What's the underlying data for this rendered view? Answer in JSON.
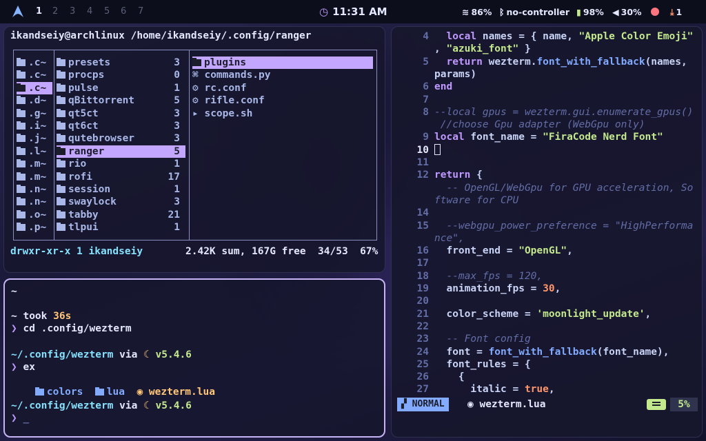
{
  "topbar": {
    "workspaces": [
      "1",
      "2",
      "3",
      "4",
      "5",
      "6",
      "7"
    ],
    "active_workspace": "1",
    "clock": "11:31 AM",
    "wifi": "86%",
    "bluetooth": "no-controller",
    "battery": "98%",
    "volume": "30%",
    "updates": "1"
  },
  "ranger": {
    "title": "ikandseiy@archlinux /home/ikandseiy/.config/ranger",
    "col1": [
      ".c~",
      ".c~",
      ".c~",
      ".d~",
      ".g~",
      ".i~",
      ".j~",
      ".l~",
      ".m~",
      ".m~",
      ".n~",
      ".n~",
      ".o~",
      ".p~"
    ],
    "col1_selected_index": 2,
    "col2": [
      {
        "name": "presets",
        "count": "3"
      },
      {
        "name": "procps",
        "count": "0"
      },
      {
        "name": "pulse",
        "count": "1"
      },
      {
        "name": "qBittorrent",
        "count": "5"
      },
      {
        "name": "qt5ct",
        "count": "3"
      },
      {
        "name": "qt6ct",
        "count": "3"
      },
      {
        "name": "qutebrowser",
        "count": "3"
      },
      {
        "name": "ranger",
        "count": "5"
      },
      {
        "name": "rio",
        "count": "1"
      },
      {
        "name": "rofi",
        "count": "17"
      },
      {
        "name": "session",
        "count": "1"
      },
      {
        "name": "swaylock",
        "count": "3"
      },
      {
        "name": "tabby",
        "count": "21"
      },
      {
        "name": "tlpui",
        "count": "1"
      }
    ],
    "col2_selected_index": 7,
    "col3": [
      {
        "name": "plugins",
        "icon": "folder-icon"
      },
      {
        "name": "commands.py",
        "icon": "python-icon"
      },
      {
        "name": "rc.conf",
        "icon": "gear-icon"
      },
      {
        "name": "rifle.conf",
        "icon": "gear-icon"
      },
      {
        "name": "scope.sh",
        "icon": "terminal-icon"
      }
    ],
    "status_perms": "drwxr-xr-x 1 ikandseiy",
    "status_info": "2.42K sum, 167G free  34/53  67%"
  },
  "terminal": {
    "line1": "~",
    "took_label": "~ took ",
    "took_value": "36s",
    "cmd1_prompt": "❯",
    "cmd1": "cd .config/wezterm",
    "path1": "~/.config/wezterm",
    "via": " via ",
    "version": "v5.4.6",
    "cmd2": "ex",
    "ls_items": [
      "colors",
      "lua",
      "wezterm.lua"
    ],
    "path2": "~/.config/wezterm",
    "prompt_end": "❯"
  },
  "editor": {
    "lines": [
      {
        "n": "4",
        "segs": [
          [
            "  ",
            ""
          ],
          [
            "local",
            "kw"
          ],
          [
            " names = { name, ",
            ""
          ],
          [
            "\"Apple Color Emoji\"",
            "str"
          ]
        ]
      },
      {
        "n": "",
        "segs": [
          [
            ", ",
            ""
          ],
          [
            "\"azuki_font\"",
            "str"
          ],
          [
            " }",
            ""
          ]
        ]
      },
      {
        "n": "5",
        "segs": [
          [
            "  ",
            ""
          ],
          [
            "return",
            "kw"
          ],
          [
            " wezterm.",
            ""
          ],
          [
            "font_with_fallback",
            "fn"
          ],
          [
            "(names,",
            ""
          ]
        ]
      },
      {
        "n": "",
        "segs": [
          [
            "params)",
            ""
          ]
        ]
      },
      {
        "n": "6",
        "segs": [
          [
            "end",
            "kw"
          ]
        ]
      },
      {
        "n": "7",
        "segs": []
      },
      {
        "n": "8",
        "segs": [
          [
            "--local gpus = wezterm.gui.enumerate_gpus()",
            "cm"
          ]
        ]
      },
      {
        "n": "",
        "segs": [
          [
            " //choose Gpu adapter (WebGpu only)",
            "cm"
          ]
        ]
      },
      {
        "n": "9",
        "segs": [
          [
            "local",
            "kw"
          ],
          [
            " font_name = ",
            ""
          ],
          [
            "\"FiraCode Nerd Font\"",
            "str"
          ]
        ]
      },
      {
        "n": "10",
        "segs": [],
        "cursor": true
      },
      {
        "n": "11",
        "segs": []
      },
      {
        "n": "12",
        "segs": [
          [
            "return",
            "kw"
          ],
          [
            " {",
            ""
          ]
        ]
      },
      {
        "n": "",
        "segs": [
          [
            "  -- OpenGL/WebGpu for GPU acceleration, So",
            "cm"
          ]
        ]
      },
      {
        "n": "",
        "segs": [
          [
            "ftware for CPU",
            "cm"
          ]
        ]
      },
      {
        "n": "14",
        "segs": []
      },
      {
        "n": "15",
        "segs": [
          [
            "  --webgpu_power_preference = \"HighPerforma",
            "cm"
          ]
        ]
      },
      {
        "n": "",
        "segs": [
          [
            "nce\",",
            "cm"
          ]
        ]
      },
      {
        "n": "16",
        "segs": [
          [
            "  front_end = ",
            ""
          ],
          [
            "\"OpenGL\"",
            "str"
          ],
          [
            ",",
            ""
          ]
        ]
      },
      {
        "n": "17",
        "segs": []
      },
      {
        "n": "18",
        "segs": [
          [
            "  --max_fps = 120,",
            "cm"
          ]
        ]
      },
      {
        "n": "19",
        "segs": [
          [
            "  animation_fps = ",
            ""
          ],
          [
            "30",
            "num"
          ],
          [
            ",",
            ""
          ]
        ]
      },
      {
        "n": "20",
        "segs": []
      },
      {
        "n": "21",
        "segs": [
          [
            "  color_scheme = ",
            ""
          ],
          [
            "'moonlight_update'",
            "str"
          ],
          [
            ",",
            ""
          ]
        ]
      },
      {
        "n": "22",
        "segs": []
      },
      {
        "n": "23",
        "segs": [
          [
            "  -- Font config",
            "cm"
          ]
        ]
      },
      {
        "n": "24",
        "segs": [
          [
            "  font = ",
            ""
          ],
          [
            "font_with_fallback",
            "fn"
          ],
          [
            "(font_name),",
            ""
          ]
        ]
      },
      {
        "n": "25",
        "segs": [
          [
            "  font_rules = {",
            ""
          ]
        ]
      },
      {
        "n": "26",
        "segs": [
          [
            "    {",
            ""
          ]
        ]
      },
      {
        "n": "27",
        "segs": [
          [
            "      italic = ",
            ""
          ],
          [
            "true",
            "num"
          ],
          [
            ",",
            ""
          ]
        ]
      }
    ],
    "current_line": "10",
    "mode": "NORMAL",
    "file": "wezterm.lua",
    "percent": "5%"
  }
}
